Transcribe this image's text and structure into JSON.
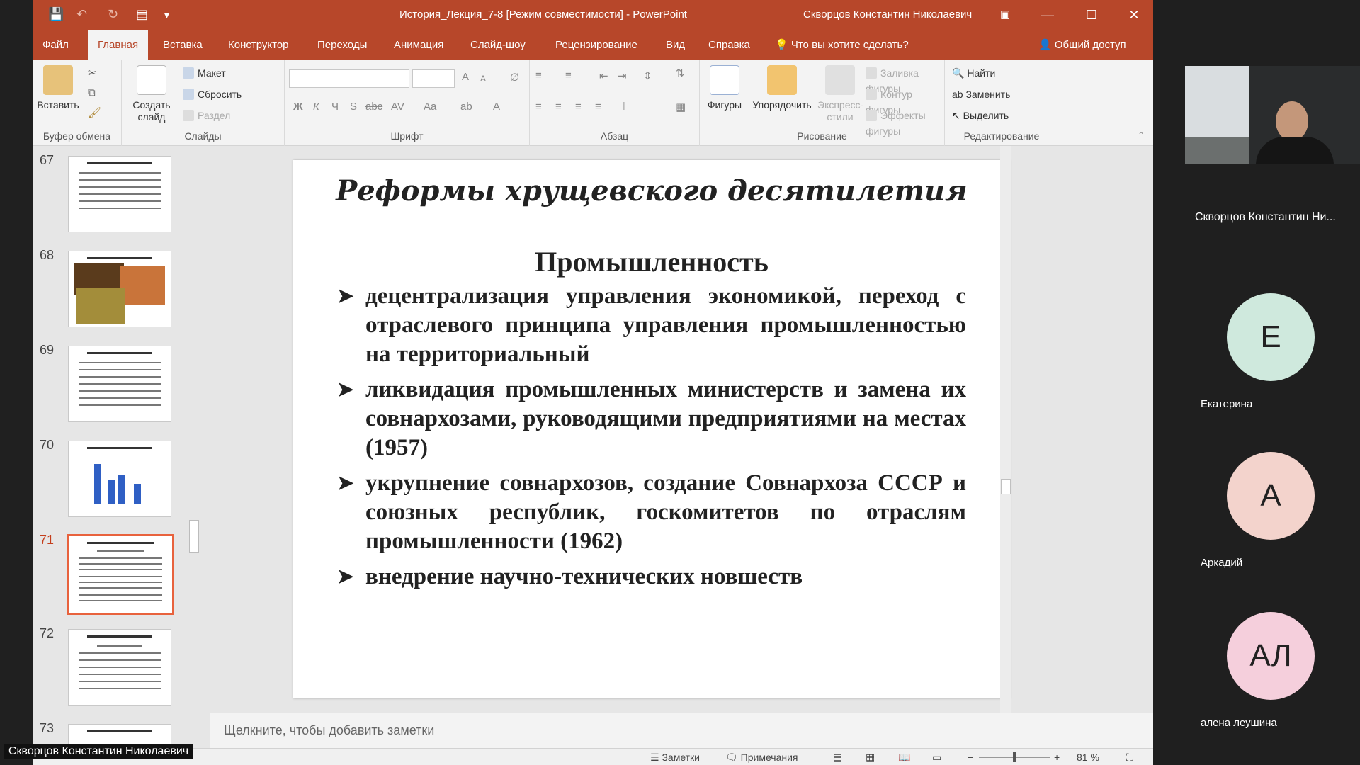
{
  "window": {
    "title": "История_Лекция_7-8 [Режим совместимости]  -  PowerPoint",
    "user": "Скворцов Константин Николаевич"
  },
  "tabs": [
    "Файл",
    "Главная",
    "Вставка",
    "Конструктор",
    "Переходы",
    "Анимация",
    "Слайд-шоу",
    "Рецензирование",
    "Вид",
    "Справка"
  ],
  "tell_me": "Что вы хотите сделать?",
  "share": "Общий доступ",
  "ribbon": {
    "clipboard": {
      "paste": "Вставить",
      "label": "Буфер обмена"
    },
    "slides": {
      "new": "Создать слайд",
      "layout": "Макет",
      "reset": "Сбросить",
      "section": "Раздел",
      "label": "Слайды"
    },
    "font": {
      "label": "Шрифт"
    },
    "paragraph": {
      "label": "Абзац"
    },
    "drawing": {
      "shapes": "Фигуры",
      "arrange": "Упорядочить",
      "quick": "Экспресс-стили",
      "fill": "Заливка фигуры",
      "outline": "Контур фигуры",
      "effects": "Эффекты фигуры",
      "label": "Рисование"
    },
    "editing": {
      "find": "Найти",
      "replace": "Заменить",
      "select": "Выделить",
      "label": "Редактирование"
    }
  },
  "thumbnails": [
    {
      "num": "67",
      "kind": "text"
    },
    {
      "num": "68",
      "kind": "image"
    },
    {
      "num": "69",
      "kind": "text"
    },
    {
      "num": "70",
      "kind": "chart"
    },
    {
      "num": "71",
      "kind": "text",
      "selected": true
    },
    {
      "num": "72",
      "kind": "text"
    },
    {
      "num": "73",
      "kind": "text"
    }
  ],
  "slide": {
    "title": "Реформы хрущевского десятилетия",
    "subtitle": "Промышленность",
    "bullets": [
      "децентрализация управления экономикой, переход с отраслевого принципа управления промышленностью на территориальный",
      "ликвидация промышленных министерств и замена их совнархозами, руководящими предприятиями на местах (1957)",
      "укрупнение совнархозов, создание Совнархоза СССР и союзных республик, госкомитетов по отраслям промышленности (1962)",
      "внедрение научно-технических новшеств"
    ]
  },
  "notes_placeholder": "Щелкните, чтобы добавить заметки",
  "status": {
    "notes": "Заметки",
    "comments": "Примечания",
    "zoom": "81 %"
  },
  "video": {
    "presenter": "Скворцов Константин Ни...",
    "overlay": "Скворцов Константин Николаевич"
  },
  "participants": [
    {
      "initials": "Е",
      "name": "Екатерина",
      "color": "#cfe9dd"
    },
    {
      "initials": "А",
      "name": "Аркадий",
      "color": "#f3d3cc"
    },
    {
      "initials": "АЛ",
      "name": "алена леушина",
      "color": "#f5cfdc"
    }
  ]
}
